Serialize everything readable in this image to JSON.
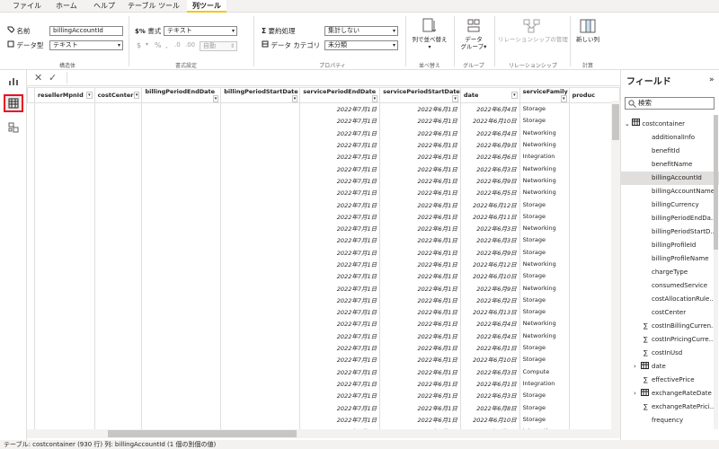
{
  "tabs": [
    "ファイル",
    "ホーム",
    "ヘルプ",
    "テーブル ツール",
    "列ツール"
  ],
  "ribbon": {
    "name_label": "名前",
    "name_value": "billingAccountId",
    "dtype_label": "データ型",
    "dtype_value": "テキスト",
    "structure_group": "構造体",
    "format_label": "書式",
    "format_value": "テキスト",
    "currency_sym": "$",
    "percent_sym": "%",
    "comma_sym": ",",
    "auto_value": "自動",
    "format_group": "書式設定",
    "summarize_label": "要約処理",
    "summarize_value": "集計しない",
    "category_label": "データ カテゴリ",
    "category_value": "未分類",
    "properties_group": "プロパティ",
    "sort_label1": "列で並べ替え",
    "sort_group": "並べ替え",
    "dgroup_label1": "データ",
    "dgroup_label2": "グループ",
    "group_group": "グループ",
    "rel_label": "リレーションシップの管理",
    "rel_group": "リレーションシップ",
    "newcol_label": "新しい列",
    "calc_group": "計算"
  },
  "columns": [
    "resellerMpnId",
    "costCenter",
    "billingPeriodEndDate",
    "billingPeriodStartDate",
    "servicePeriodEndDate",
    "servicePeriodStartDate",
    "date",
    "serviceFamily",
    "produc"
  ],
  "rows": [
    [
      "2022年7月1日",
      "2022年6月1日",
      "2022年6月4日",
      "Storage"
    ],
    [
      "2022年7月1日",
      "2022年6月1日",
      "2022年6月10日",
      "Storage"
    ],
    [
      "2022年7月1日",
      "2022年6月1日",
      "2022年6月4日",
      "Networking"
    ],
    [
      "2022年7月1日",
      "2022年6月1日",
      "2022年6月9日",
      "Networking"
    ],
    [
      "2022年7月1日",
      "2022年6月1日",
      "2022年6月6日",
      "Integration"
    ],
    [
      "2022年7月1日",
      "2022年6月1日",
      "2022年6月3日",
      "Networking"
    ],
    [
      "2022年7月1日",
      "2022年6月1日",
      "2022年6月9日",
      "Networking"
    ],
    [
      "2022年7月1日",
      "2022年6月1日",
      "2022年6月5日",
      "Networking"
    ],
    [
      "2022年7月1日",
      "2022年6月1日",
      "2022年6月12日",
      "Storage"
    ],
    [
      "2022年7月1日",
      "2022年6月1日",
      "2022年6月11日",
      "Storage"
    ],
    [
      "2022年7月1日",
      "2022年6月1日",
      "2022年6月3日",
      "Networking"
    ],
    [
      "2022年7月1日",
      "2022年6月1日",
      "2022年6月3日",
      "Storage"
    ],
    [
      "2022年7月1日",
      "2022年6月1日",
      "2022年6月9日",
      "Storage"
    ],
    [
      "2022年7月1日",
      "2022年6月1日",
      "2022年6月12日",
      "Networking"
    ],
    [
      "2022年7月1日",
      "2022年6月1日",
      "2022年6月10日",
      "Storage"
    ],
    [
      "2022年7月1日",
      "2022年6月1日",
      "2022年6月9日",
      "Networking"
    ],
    [
      "2022年7月1日",
      "2022年6月1日",
      "2022年6月2日",
      "Storage"
    ],
    [
      "2022年7月1日",
      "2022年6月1日",
      "2022年6月13日",
      "Storage"
    ],
    [
      "2022年7月1日",
      "2022年6月1日",
      "2022年6月4日",
      "Networking"
    ],
    [
      "2022年7月1日",
      "2022年6月1日",
      "2022年6月4日",
      "Networking"
    ],
    [
      "2022年7月1日",
      "2022年6月1日",
      "2022年6月1日",
      "Storage"
    ],
    [
      "2022年7月1日",
      "2022年6月1日",
      "2022年6月10日",
      "Storage"
    ],
    [
      "2022年7月1日",
      "2022年6月1日",
      "2022年6月3日",
      "Compute"
    ],
    [
      "2022年7月1日",
      "2022年6月1日",
      "2022年6月1日",
      "Integration"
    ],
    [
      "2022年7月1日",
      "2022年6月1日",
      "2022年6月3日",
      "Storage"
    ],
    [
      "2022年7月1日",
      "2022年6月1日",
      "2022年6月8日",
      "Storage"
    ],
    [
      "2022年7月1日",
      "2022年6月1日",
      "2022年6月10日",
      "Storage"
    ],
    [
      "2022年7月1日",
      "2022年6月1日",
      "2022年6月4日",
      "Integration"
    ]
  ],
  "fields": {
    "title": "フィールド",
    "search_placeholder": "検索",
    "table_name": "costcontainer",
    "items": [
      {
        "name": "additionalInfo",
        "kind": "text"
      },
      {
        "name": "benefitId",
        "kind": "text"
      },
      {
        "name": "benefitName",
        "kind": "text"
      },
      {
        "name": "billingAccountId",
        "kind": "text",
        "selected": true
      },
      {
        "name": "billingAccountName",
        "kind": "text"
      },
      {
        "name": "billingCurrency",
        "kind": "text"
      },
      {
        "name": "billingPeriodEndDa...",
        "kind": "text"
      },
      {
        "name": "billingPeriodStartD...",
        "kind": "text"
      },
      {
        "name": "billingProfileId",
        "kind": "text"
      },
      {
        "name": "billingProfileName",
        "kind": "text"
      },
      {
        "name": "chargeType",
        "kind": "text"
      },
      {
        "name": "consumedService",
        "kind": "text"
      },
      {
        "name": "costAllocationRule...",
        "kind": "text"
      },
      {
        "name": "costCenter",
        "kind": "text"
      },
      {
        "name": "costInBillingCurren...",
        "kind": "sum"
      },
      {
        "name": "costInPricingCurre...",
        "kind": "sum"
      },
      {
        "name": "costInUsd",
        "kind": "sum"
      },
      {
        "name": "date",
        "kind": "date"
      },
      {
        "name": "effectivePrice",
        "kind": "sum"
      },
      {
        "name": "exchangeRateDate",
        "kind": "date"
      },
      {
        "name": "exchangeRatePrici...",
        "kind": "sum"
      },
      {
        "name": "frequency",
        "kind": "text"
      }
    ]
  },
  "status_text": "テーブル: costcontainer (930 行) 列: billingAccountId (1 個の別個の値)"
}
